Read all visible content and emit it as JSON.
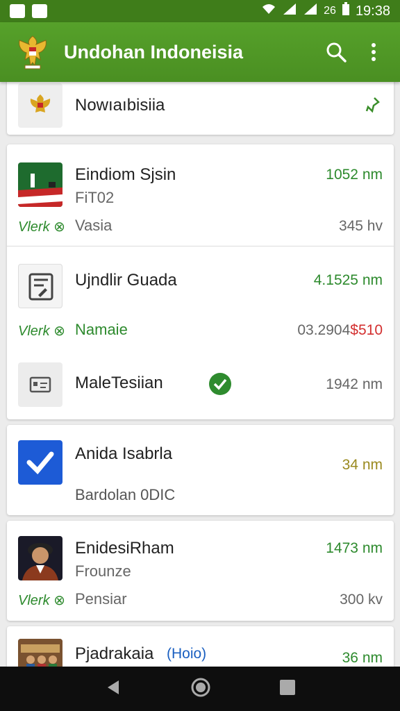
{
  "status_bar": {
    "time": "19:38",
    "battery": "26"
  },
  "app_bar": {
    "title": "Undohan Indoneisia"
  },
  "cards": {
    "c0": {
      "title": "Nowıaıbisiia"
    },
    "c1": {
      "title": "Eindiom Sjsin",
      "subtitle": "FiT02",
      "link": "Vlerk ⊗",
      "label": "Vasia",
      "right_top": "1052 nm",
      "right_bottom": "345 hv"
    },
    "c2a": {
      "title": "Ujndlir Guada",
      "right_top": "4.1525 nm",
      "link": "Vlerk ⊗",
      "label": "Namaie",
      "right_bottom_gray": "03.2904",
      "right_bottom_red": "$510"
    },
    "c2b": {
      "title": "MaleTesiian",
      "right": "1942 nm"
    },
    "c3": {
      "title": "Anida Isabrla",
      "subtitle": "Bardolan 0DIC",
      "right": "34 nm"
    },
    "c4": {
      "title": "EnidesiRham",
      "subtitle": "Frounze",
      "link": "Vlerk ⊗",
      "label": "Pensiar",
      "right_top": "1473 nm",
      "right_bottom": "300 kv"
    },
    "c5": {
      "title": "Pjadrakaia",
      "badge": "(Hoio)",
      "right": "36 nm"
    }
  }
}
